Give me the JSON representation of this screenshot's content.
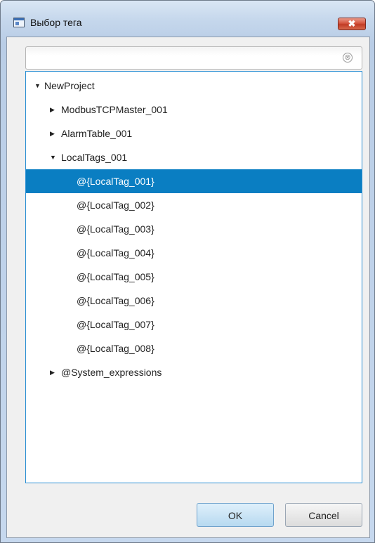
{
  "window": {
    "title": "Выбор тега",
    "close_label": "✖"
  },
  "search": {
    "value": "",
    "placeholder": "",
    "clear_icon": "⊗"
  },
  "tree": {
    "items": [
      {
        "label": "NewProject",
        "arrow": "▼"
      },
      {
        "label": "ModbusTCPMaster_001",
        "arrow": "▶"
      },
      {
        "label": "AlarmTable_001",
        "arrow": "▶"
      },
      {
        "label": "LocalTags_001",
        "arrow": "▼"
      },
      {
        "label": "@{LocalTag_001}"
      },
      {
        "label": "@{LocalTag_002}"
      },
      {
        "label": "@{LocalTag_003}"
      },
      {
        "label": "@{LocalTag_004}"
      },
      {
        "label": "@{LocalTag_005}"
      },
      {
        "label": "@{LocalTag_006}"
      },
      {
        "label": "@{LocalTag_007}"
      },
      {
        "label": "@{LocalTag_008}"
      },
      {
        "label": "@System_expressions",
        "arrow": "▶"
      }
    ],
    "selected_label": "@{LocalTag_001}"
  },
  "buttons": {
    "ok_label": "OK",
    "cancel_label": "Cancel"
  },
  "colors": {
    "selection": "#0a7ec2",
    "tree_border": "#2a8fd3",
    "close_button": "#c13b25"
  }
}
